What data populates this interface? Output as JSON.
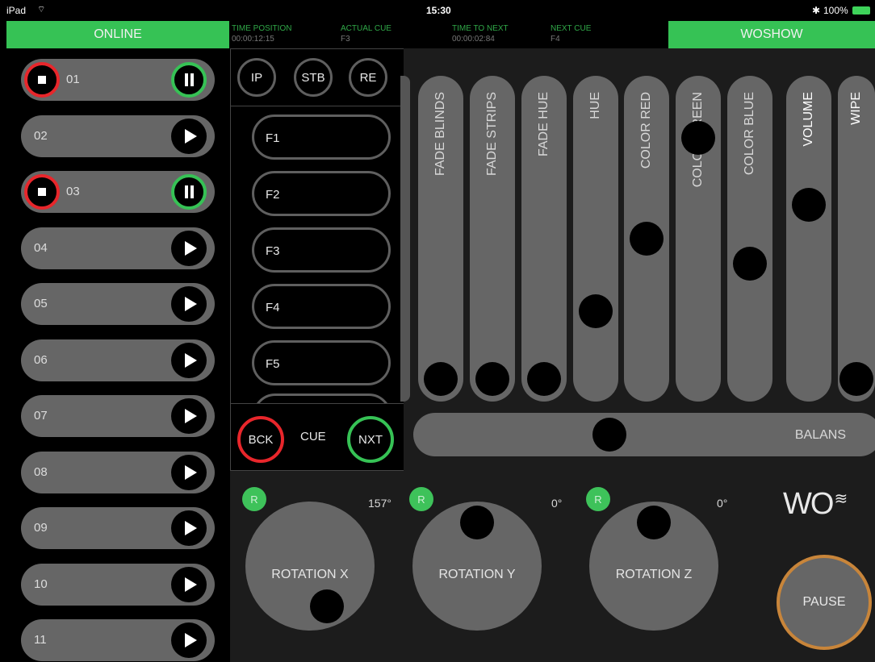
{
  "status_bar": {
    "device": "iPad",
    "time": "15:30",
    "battery": "100%"
  },
  "header": {
    "left_label": "ONLINE",
    "right_label": "WOSHOW",
    "info": [
      {
        "label": "TIME POSITION",
        "value": "00:00:12:15"
      },
      {
        "label": "ACTUAL CUE",
        "value": "F3"
      },
      {
        "label": "TIME TO NEXT",
        "value": "00:00:02:84"
      },
      {
        "label": "NEXT CUE",
        "value": "F4"
      }
    ]
  },
  "cue_list": [
    {
      "label": "01",
      "state": "playing"
    },
    {
      "label": "02",
      "state": "idle"
    },
    {
      "label": "03",
      "state": "playing"
    },
    {
      "label": "04",
      "state": "idle"
    },
    {
      "label": "05",
      "state": "idle"
    },
    {
      "label": "06",
      "state": "idle"
    },
    {
      "label": "07",
      "state": "idle"
    },
    {
      "label": "08",
      "state": "idle"
    },
    {
      "label": "09",
      "state": "idle"
    },
    {
      "label": "10",
      "state": "idle"
    },
    {
      "label": "11",
      "state": "idle"
    }
  ],
  "top_buttons": {
    "ip": "IP",
    "stb": "STB",
    "re": "RE"
  },
  "function_cues": [
    "F1",
    "F2",
    "F3",
    "F4",
    "F5"
  ],
  "cue_nav": {
    "back": "BCK",
    "label": "CUE",
    "next": "NXT"
  },
  "sliders": [
    {
      "label": "FADE BLINDS",
      "level": 0.0
    },
    {
      "label": "FADE STRIPS",
      "level": 0.0
    },
    {
      "label": "FADE HUE",
      "level": 0.0
    },
    {
      "label": "HUE",
      "level": 0.24
    },
    {
      "label": "COLOR RED",
      "level": 0.5
    },
    {
      "label": "COLOR GREEN",
      "level": 0.86
    },
    {
      "label": "COLOR BLUE",
      "level": 0.41
    },
    {
      "label": "VOLUME",
      "level": 0.62
    },
    {
      "label": "WIPE",
      "level": 0.0
    }
  ],
  "balance": {
    "label": "BALANS",
    "level": 0.41
  },
  "rotations": [
    {
      "label": "ROTATION X",
      "badge": "R",
      "degrees": "157°",
      "angle": 157
    },
    {
      "label": "ROTATION Y",
      "badge": "R",
      "degrees": "0°",
      "angle": 0
    },
    {
      "label": "ROTATION Z",
      "badge": "R",
      "degrees": "0°",
      "angle": 0
    }
  ],
  "logo_text": "WO",
  "pause_label": "PAUSE",
  "colors": {
    "green": "#36c255",
    "red": "#e8262b",
    "orange": "#c8853a",
    "slider_gray": "#666666"
  }
}
